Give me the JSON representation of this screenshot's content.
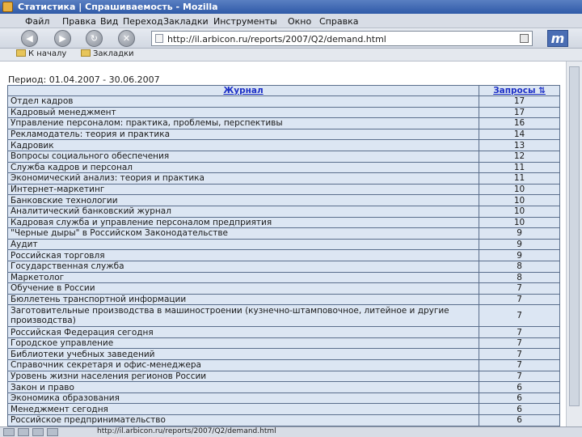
{
  "window": {
    "title": "Статистика | Спрашиваемость - Mozilla"
  },
  "menu": [
    "Файл",
    "Правка",
    "Вид",
    "Переход",
    "Закладки",
    "Инструменты",
    "Окно",
    "Справка"
  ],
  "nav": {
    "back": "back-arrow-icon",
    "forward": "forward-arrow-icon",
    "reload": "reload-icon",
    "stop": "stop-icon",
    "url": "http://il.arbicon.ru/reports/2007/Q2/demand.html"
  },
  "bookmarks": [
    "К началу",
    "Закладки"
  ],
  "report": {
    "period": "Период: 01.04.2007 - 30.06.2007",
    "headers": {
      "journal": "Журнал",
      "requests": "Запросы ⇅"
    },
    "rows": [
      {
        "name": "Отдел кадров",
        "count": "17"
      },
      {
        "name": "Кадровый менеджмент",
        "count": "17"
      },
      {
        "name": "Управление персоналом: практика, проблемы, перспективы",
        "count": "16"
      },
      {
        "name": "Рекламодатель: теория и практика",
        "count": "14"
      },
      {
        "name": "Кадровик",
        "count": "13"
      },
      {
        "name": "Вопросы социального обеспечения",
        "count": "12"
      },
      {
        "name": "Служба кадров и персонал",
        "count": "11"
      },
      {
        "name": "Экономический анализ: теория и практика",
        "count": "11"
      },
      {
        "name": "Интернет-маркетинг",
        "count": "10"
      },
      {
        "name": "Банковские технологии",
        "count": "10"
      },
      {
        "name": "Аналитический банковский журнал",
        "count": "10"
      },
      {
        "name": "Кадровая служба и управление персоналом предприятия",
        "count": "10"
      },
      {
        "name": "\"Черные дыры\" в Российском Законодательстве",
        "count": "9"
      },
      {
        "name": "Аудит",
        "count": "9"
      },
      {
        "name": "Российская торговля",
        "count": "9"
      },
      {
        "name": "Государственная служба",
        "count": "8"
      },
      {
        "name": "Маркетолог",
        "count": "8"
      },
      {
        "name": "Обучение в России",
        "count": "7"
      },
      {
        "name": "Бюллетень транспортной информации",
        "count": "7"
      },
      {
        "name": "Заготовительные производства в машиностроении (кузнечно-штамповочное, литейное и другие производства)",
        "count": "7"
      },
      {
        "name": "Российская Федерация сегодня",
        "count": "7"
      },
      {
        "name": "Городское управление",
        "count": "7"
      },
      {
        "name": "Библиотеки учебных заведений",
        "count": "7"
      },
      {
        "name": "Справочник секретаря и офис-менеджера",
        "count": "7"
      },
      {
        "name": "Уровень жизни населения регионов России",
        "count": "7"
      },
      {
        "name": "Закон и право",
        "count": "6"
      },
      {
        "name": "Экономика образования",
        "count": "6"
      },
      {
        "name": "Менеджмент сегодня",
        "count": "6"
      },
      {
        "name": "Российское предпринимательство",
        "count": "6"
      }
    ]
  },
  "status": {
    "text": "http://il.arbicon.ru/reports/2007/Q2/demand.html"
  }
}
